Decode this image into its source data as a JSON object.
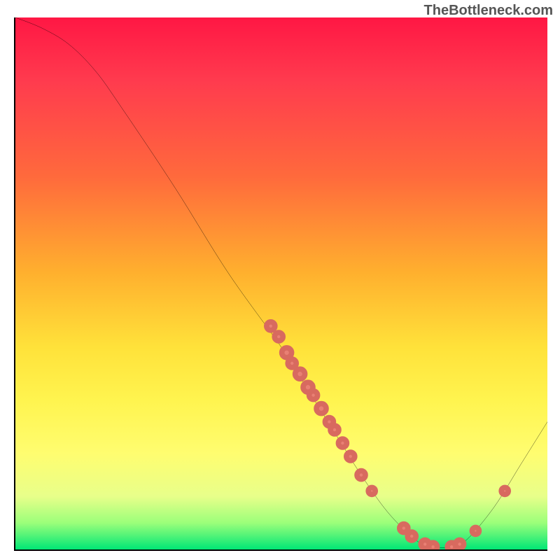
{
  "watermark": "TheBottleneck.com",
  "chart_data": {
    "type": "line",
    "title": "",
    "xlabel": "",
    "ylabel": "",
    "xlim": [
      0,
      100
    ],
    "ylim": [
      0,
      100
    ],
    "curve": [
      {
        "x": 0,
        "y": 100
      },
      {
        "x": 5,
        "y": 98
      },
      {
        "x": 10,
        "y": 95
      },
      {
        "x": 15,
        "y": 90
      },
      {
        "x": 20,
        "y": 83
      },
      {
        "x": 30,
        "y": 68
      },
      {
        "x": 40,
        "y": 52
      },
      {
        "x": 50,
        "y": 38
      },
      {
        "x": 55,
        "y": 30
      },
      {
        "x": 60,
        "y": 22
      },
      {
        "x": 65,
        "y": 14
      },
      {
        "x": 70,
        "y": 7
      },
      {
        "x": 75,
        "y": 2
      },
      {
        "x": 78,
        "y": 0.5
      },
      {
        "x": 82,
        "y": 0.5
      },
      {
        "x": 85,
        "y": 2
      },
      {
        "x": 90,
        "y": 8
      },
      {
        "x": 95,
        "y": 16
      },
      {
        "x": 100,
        "y": 24
      }
    ],
    "dots": [
      {
        "x": 48,
        "y": 42,
        "r": 6
      },
      {
        "x": 49.5,
        "y": 40,
        "r": 6
      },
      {
        "x": 51,
        "y": 37,
        "r": 7
      },
      {
        "x": 52,
        "y": 35,
        "r": 6
      },
      {
        "x": 53.5,
        "y": 33,
        "r": 7
      },
      {
        "x": 55,
        "y": 30.5,
        "r": 7
      },
      {
        "x": 56,
        "y": 29,
        "r": 6
      },
      {
        "x": 57.5,
        "y": 26.5,
        "r": 7
      },
      {
        "x": 59,
        "y": 24,
        "r": 6
      },
      {
        "x": 60,
        "y": 22.5,
        "r": 6
      },
      {
        "x": 61.5,
        "y": 20,
        "r": 6
      },
      {
        "x": 63,
        "y": 17.5,
        "r": 6
      },
      {
        "x": 65,
        "y": 14,
        "r": 6
      },
      {
        "x": 67,
        "y": 11,
        "r": 5
      },
      {
        "x": 73,
        "y": 4,
        "r": 6
      },
      {
        "x": 74.5,
        "y": 2.5,
        "r": 6
      },
      {
        "x": 77,
        "y": 1,
        "r": 6
      },
      {
        "x": 78.5,
        "y": 0.5,
        "r": 6
      },
      {
        "x": 82,
        "y": 0.5,
        "r": 6
      },
      {
        "x": 83.5,
        "y": 1,
        "r": 6
      },
      {
        "x": 86.5,
        "y": 3.5,
        "r": 5
      },
      {
        "x": 92,
        "y": 11,
        "r": 5
      }
    ]
  }
}
